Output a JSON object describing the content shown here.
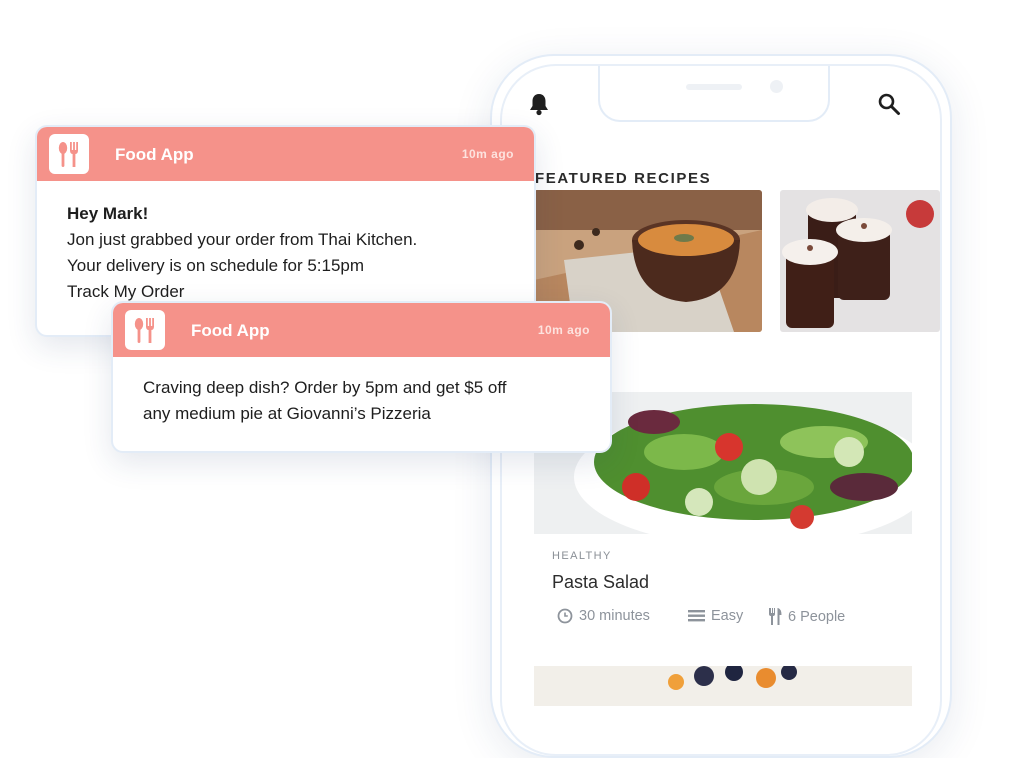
{
  "phone": {
    "section_title": "FEATURED RECIPES",
    "card": {
      "category": "HEALTHY",
      "title": "Pasta Salad",
      "time": "30 minutes",
      "level": "Easy",
      "people": "6 People"
    },
    "icons": {
      "bell": "bell-icon",
      "search": "search-icon",
      "clock": "clock-icon",
      "level": "difficulty-icon",
      "utensils": "utensils-icon"
    }
  },
  "notifications": [
    {
      "app_name": "Food App",
      "timestamp": "10m ago",
      "greeting": "Hey Mark!",
      "lines": [
        "Jon just grabbed your order from Thai Kitchen.",
        "Your delivery is on schedule for 5:15pm",
        "Track My Order"
      ]
    },
    {
      "app_name": "Food App",
      "timestamp": "10m ago",
      "lines": [
        "Craving deep dish? Order by 5pm and get $5 off",
        "any medium pie at Giovanni’s Pizzeria"
      ]
    }
  ],
  "colors": {
    "accent": "#f5928a",
    "muted_text": "#8d939b",
    "border": "#e3ecf7"
  }
}
